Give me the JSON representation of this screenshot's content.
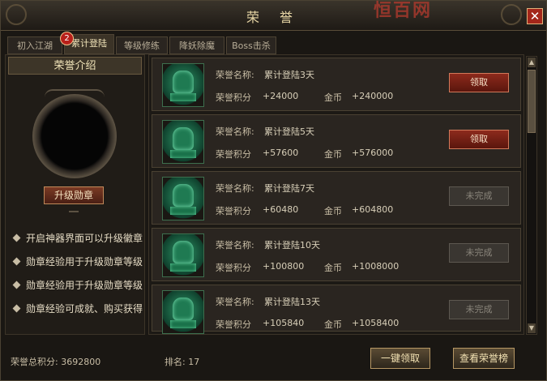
{
  "window": {
    "title": "荣 誉",
    "watermark": "恒百网",
    "close_glyph": "✕"
  },
  "tabs": [
    {
      "label": "初入江湖"
    },
    {
      "label": "累计登陆",
      "badge": "2",
      "active": true
    },
    {
      "label": "等级修练"
    },
    {
      "label": "降妖除魔"
    },
    {
      "label": "Boss击杀"
    }
  ],
  "left_panel": {
    "heading": "荣誉介绍",
    "upgrade_button": "升级勋章",
    "tips": [
      "开启神器界面可以升级徽章",
      "勋章经验用于升级勋章等级",
      "勋章经验用于升级勋章等级",
      "勋章经验可成就、购买获得"
    ]
  },
  "labels": {
    "honor_name": "荣誉名称:",
    "honor_points": "荣誉积分",
    "gold": "金币"
  },
  "rows": [
    {
      "name": "累计登陆3天",
      "points": "+24000",
      "gold": "+240000",
      "button": "领取",
      "status": "claim"
    },
    {
      "name": "累计登陆5天",
      "points": "+57600",
      "gold": "+576000",
      "button": "领取",
      "status": "claim"
    },
    {
      "name": "累计登陆7天",
      "points": "+60480",
      "gold": "+604800",
      "button": "未完成",
      "status": "done"
    },
    {
      "name": "累计登陆10天",
      "points": "+100800",
      "gold": "+1008000",
      "button": "未完成",
      "status": "done"
    },
    {
      "name": "累计登陆13天",
      "points": "+105840",
      "gold": "+1058400",
      "button": "未完成",
      "status": "done"
    }
  ],
  "scroll": {
    "up": "▲",
    "down": "▼"
  },
  "footer": {
    "total_points": "荣誉总积分: 3692800",
    "rank": "排名: 17",
    "claim_all_button": "一键领取",
    "leaderboard_button": "查看荣誉榜"
  },
  "colors": {
    "accent_gold": "#f0e3b8",
    "claim_red": "#8d2a1c",
    "jade_green": "#1f7a52"
  }
}
